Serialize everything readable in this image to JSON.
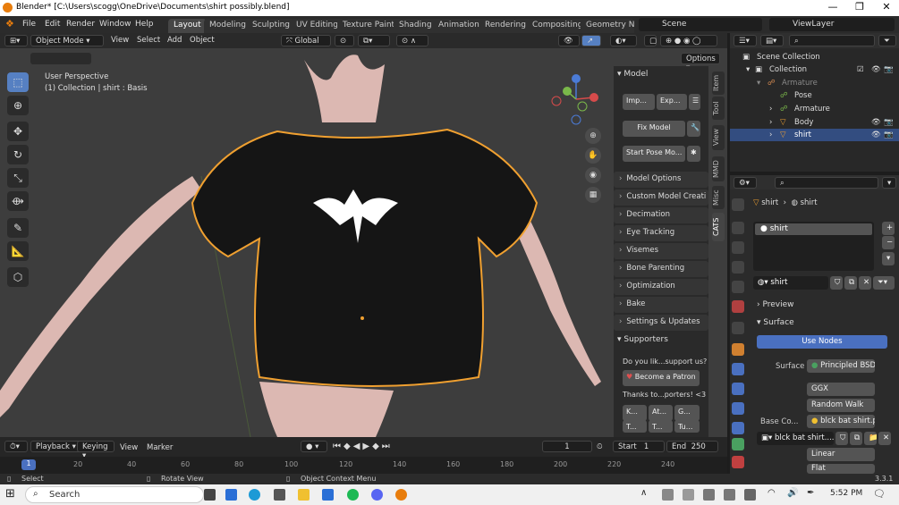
{
  "window": {
    "title": "Blender* [C:\\Users\\scogg\\OneDrive\\Documents\\shirt possibly.blend]",
    "controls": [
      "—",
      "❐",
      "✕"
    ]
  },
  "menu": {
    "items": [
      "File",
      "Edit",
      "Render",
      "Window",
      "Help"
    ]
  },
  "workspaces": [
    "Layout",
    "Modeling",
    "Sculpting",
    "UV Editing",
    "Texture Paint",
    "Shading",
    "Animation",
    "Rendering",
    "Compositing",
    "Geometry Noc"
  ],
  "scene": {
    "label": "Scene",
    "viewlayer": "ViewLayer"
  },
  "viewport_header": {
    "mode": "Object Mode",
    "menus": [
      "View",
      "Select",
      "Add",
      "Object"
    ],
    "orientation": "Global",
    "options": "Options"
  },
  "viewport": {
    "overlay_line1": "User Perspective",
    "overlay_line2": "(1) Collection | shirt : Basis",
    "shirt_color": "#151515",
    "outline_color": "#f0a030",
    "skin_color": "#dcb8b2"
  },
  "npanel": {
    "model_header": "Model",
    "btn_import": "Imp...",
    "btn_export": "Exp...",
    "btn_fix": "Fix Model",
    "btn_pose": "Start Pose Mo...",
    "sections": [
      "Model Options",
      "Custom Model Creati",
      "Decimation",
      "Eye Tracking",
      "Visemes",
      "Bone Parenting",
      "Optimization",
      "Bake",
      "Settings & Updates"
    ],
    "supporters_header": "Supporters",
    "support_text": "Do you lik...support us?",
    "patron": "Become a Patron",
    "thanks": "Thanks to...porters! <3",
    "supporter_names": [
      "K...",
      "At...",
      "G...",
      "T...",
      "T...",
      "Tu..."
    ],
    "tabs": [
      "Item",
      "Tool",
      "View",
      "MMD",
      "Misc",
      "CATS"
    ]
  },
  "outliner": {
    "rows": [
      {
        "label": "Scene Collection"
      },
      {
        "label": "Collection"
      },
      {
        "label": "Armature"
      },
      {
        "label": "Pose"
      },
      {
        "label": "Armature"
      },
      {
        "label": "Body"
      },
      {
        "label": "shirt"
      }
    ]
  },
  "properties": {
    "breadcrumb_obj": "shirt",
    "breadcrumb_mat": "shirt",
    "slot": "shirt",
    "material": "shirt",
    "preview": "Preview",
    "surface": "Surface",
    "use_nodes": "Use Nodes",
    "surface_label": "Surface",
    "shader": "Principled BSDF",
    "distribution": "GGX",
    "subsurface": "Random Walk",
    "base_color_label": "Base Co...",
    "base_color_value": "blck bat shirt.p...",
    "image": "blck bat shirt....",
    "interp": "Linear",
    "proj": "Flat"
  },
  "timeline": {
    "playback": "Playback",
    "keying": "Keying",
    "view": "View",
    "marker": "Marker",
    "current_frame": "1",
    "start_label": "Start",
    "start": "1",
    "end_label": "End",
    "end": "250",
    "ticks": [
      "1",
      "20",
      "40",
      "60",
      "80",
      "100",
      "120",
      "140",
      "160",
      "180",
      "200",
      "220",
      "240"
    ]
  },
  "statusbar": {
    "select": "Select",
    "rotate": "Rotate View",
    "context": "Object Context Menu",
    "version": "3.3.1"
  },
  "taskbar": {
    "search": "Search",
    "time": "5:52 PM"
  }
}
